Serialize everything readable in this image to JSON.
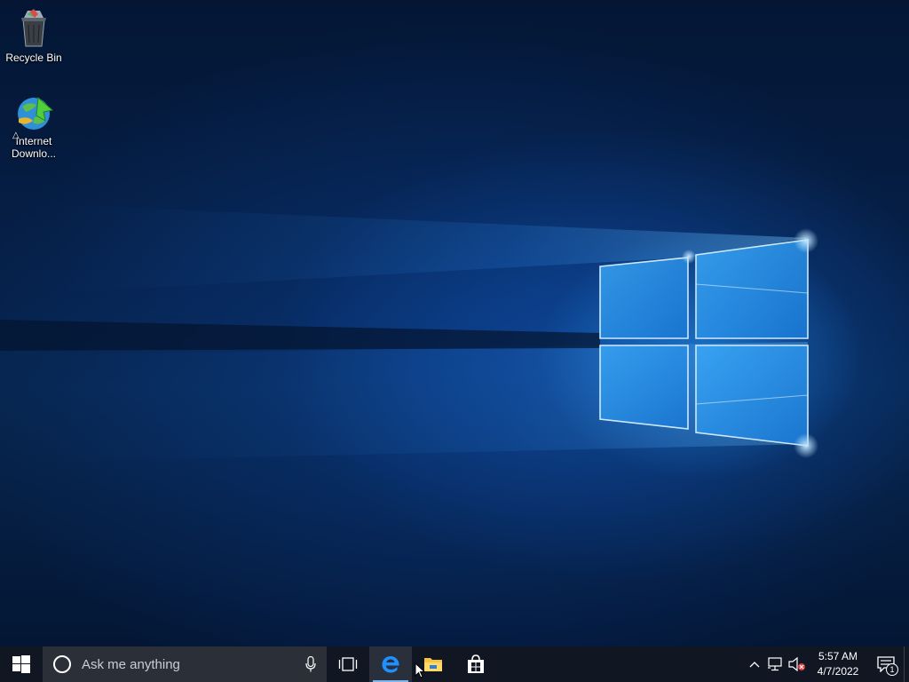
{
  "desktop": {
    "icons": [
      {
        "label": "Recycle Bin",
        "icon": "recycle-bin-icon"
      },
      {
        "label": "Internet Downlo...",
        "icon": "internet-download-manager-icon"
      }
    ]
  },
  "taskbar": {
    "start_icon": "windows-logo-icon",
    "search": {
      "placeholder": "Ask me anything",
      "icon": "cortana-circle-icon",
      "mic_icon": "microphone-icon"
    },
    "pinned": [
      {
        "name": "Task View",
        "icon": "task-view-icon"
      },
      {
        "name": "Microsoft Edge",
        "icon": "edge-icon"
      },
      {
        "name": "File Explorer",
        "icon": "file-explorer-icon"
      },
      {
        "name": "Store",
        "icon": "store-icon"
      }
    ],
    "tray": {
      "icons": [
        "chevron-up-icon",
        "network-icon",
        "volume-muted-icon"
      ],
      "time": "5:57 AM",
      "date": "4/7/2022",
      "notification_count": "1"
    }
  },
  "colors": {
    "taskbar": "#101723",
    "search_bg": "#2b2f37",
    "accent": "#1e90ff"
  }
}
